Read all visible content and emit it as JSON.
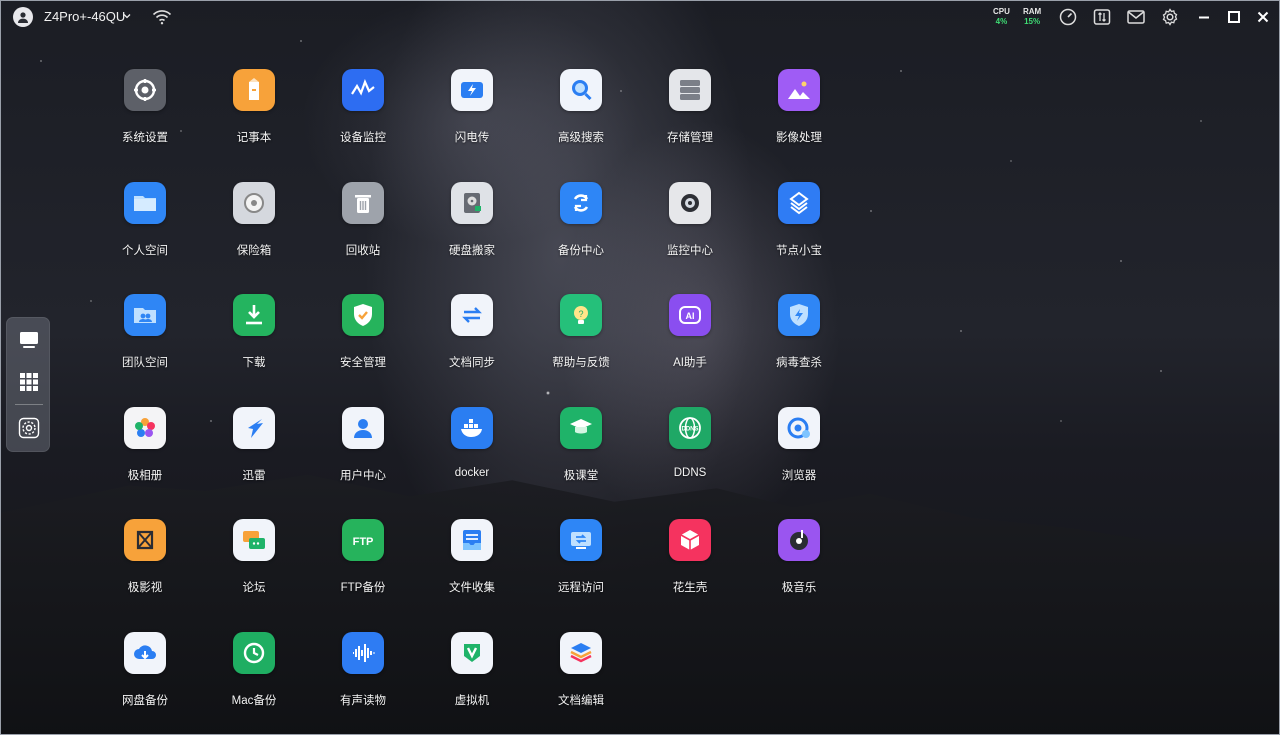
{
  "titlebar": {
    "device_name": "Z4Pro+-46QU",
    "cpu_label": "CPU",
    "cpu_value": "4%",
    "ram_label": "RAM",
    "ram_value": "15%"
  },
  "apps": [
    {
      "label": "系统设置",
      "icon": "gear-icon",
      "color": "#5d6068"
    },
    {
      "label": "记事本",
      "icon": "pencil-icon",
      "color": "#f7a23a"
    },
    {
      "label": "设备监控",
      "icon": "monitor-wave-icon",
      "color": "#2d6df2"
    },
    {
      "label": "闪电传",
      "icon": "lightning-icon",
      "color": "#f1f4fa"
    },
    {
      "label": "高级搜索",
      "icon": "search-icon",
      "color": "#f0f4fb"
    },
    {
      "label": "存储管理",
      "icon": "storage-icon",
      "color": "#e4e6ea"
    },
    {
      "label": "影像处理",
      "icon": "image-icon",
      "color": "#9f5cf5"
    },
    {
      "label": "个人空间",
      "icon": "folder-icon",
      "color": "#2f86f5"
    },
    {
      "label": "保险箱",
      "icon": "safe-icon",
      "color": "#d5d8de"
    },
    {
      "label": "回收站",
      "icon": "trash-icon",
      "color": "#9ea3ab"
    },
    {
      "label": "硬盘搬家",
      "icon": "disk-icon",
      "color": "#dfe2e7"
    },
    {
      "label": "备份中心",
      "icon": "backup-icon",
      "color": "#2e86f6"
    },
    {
      "label": "监控中心",
      "icon": "camera-icon",
      "color": "#e6e7ea"
    },
    {
      "label": "节点小宝",
      "icon": "node-icon",
      "color": "#2f7cf4"
    },
    {
      "label": "团队空间",
      "icon": "team-folder-icon",
      "color": "#2f86f5"
    },
    {
      "label": "下载",
      "icon": "download-icon",
      "color": "#24b45f"
    },
    {
      "label": "安全管理",
      "icon": "shield-check-icon",
      "color": "#26b35c"
    },
    {
      "label": "文档同步",
      "icon": "sync-icon",
      "color": "#f1f4fa"
    },
    {
      "label": "帮助与反馈",
      "icon": "help-bulb-icon",
      "color": "#25c07a"
    },
    {
      "label": "AI助手",
      "icon": "ai-icon",
      "color": "#8a4ef0"
    },
    {
      "label": "病毒查杀",
      "icon": "antivirus-icon",
      "color": "#2f86f5"
    },
    {
      "label": "极相册",
      "icon": "photos-icon",
      "color": "#f4f4f6"
    },
    {
      "label": "迅雷",
      "icon": "thunder-icon",
      "color": "#f1f4fa"
    },
    {
      "label": "用户中心",
      "icon": "user-icon",
      "color": "#f1f4fa"
    },
    {
      "label": "docker",
      "icon": "docker-icon",
      "color": "#2b7ef2"
    },
    {
      "label": "极课堂",
      "icon": "graduation-icon",
      "color": "#1fb369"
    },
    {
      "label": "DDNS",
      "icon": "ddns-icon",
      "color": "#1fa866"
    },
    {
      "label": "浏览器",
      "icon": "browser-icon",
      "color": "#f1f4fa"
    },
    {
      "label": "极影视",
      "icon": "video-icon",
      "color": "#f7a23a"
    },
    {
      "label": "论坛",
      "icon": "forum-icon",
      "color": "#f1f4fa"
    },
    {
      "label": "FTP备份",
      "icon": "ftp-icon",
      "color": "#26b35c"
    },
    {
      "label": "文件收集",
      "icon": "inbox-icon",
      "color": "#f1f4fa"
    },
    {
      "label": "远程访问",
      "icon": "remote-icon",
      "color": "#2e86f6"
    },
    {
      "label": "花生壳",
      "icon": "peanut-icon",
      "color": "#f5335f"
    },
    {
      "label": "极音乐",
      "icon": "music-icon",
      "color": "#9a55f0"
    },
    {
      "label": "网盘备份",
      "icon": "cloud-download-icon",
      "color": "#f1f4fa"
    },
    {
      "label": "Mac备份",
      "icon": "time-machine-icon",
      "color": "#1fae62"
    },
    {
      "label": "有声读物",
      "icon": "audiobook-icon",
      "color": "#2e7cf3"
    },
    {
      "label": "虚拟机",
      "icon": "vm-icon",
      "color": "#f1f4fa"
    },
    {
      "label": "文档编辑",
      "icon": "layers-icon",
      "color": "#f1f4fa"
    }
  ]
}
